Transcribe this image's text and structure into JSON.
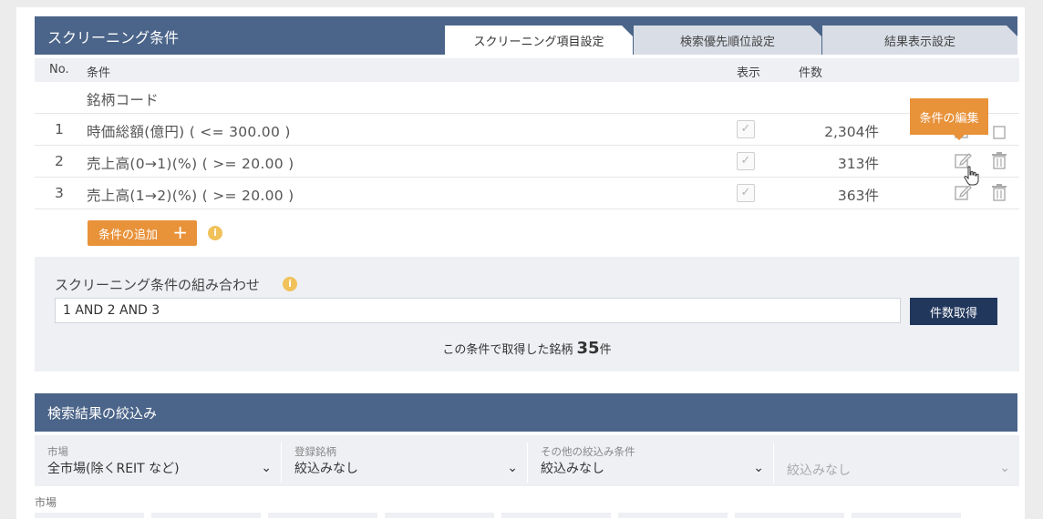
{
  "header": {
    "title": "スクリーニング条件",
    "tabs": [
      {
        "label": "スクリーニング項目設定",
        "active": true
      },
      {
        "label": "検索優先順位設定",
        "active": false
      },
      {
        "label": "結果表示設定",
        "active": false
      }
    ]
  },
  "columns": {
    "no": "No.",
    "condition": "条件",
    "display": "表示",
    "count": "件数"
  },
  "rows": [
    {
      "no": "",
      "condition": "銘柄コード",
      "count": ""
    },
    {
      "no": "1",
      "condition": "時価総額(億円) ( <= 300.00 )",
      "count": "2,304件"
    },
    {
      "no": "2",
      "condition": "売上高(0→1)(%) ( >= 20.00 )",
      "count": "313件"
    },
    {
      "no": "3",
      "condition": "売上高(1→2)(%) ( >= 20.00 )",
      "count": "363件"
    }
  ],
  "tooltip": "条件の編集",
  "add_condition": {
    "label": "条件の追加",
    "plus": "+"
  },
  "combination": {
    "title": "スクリーニング条件の組み合わせ",
    "value": "1 AND 2 AND 3",
    "button": "件数取得",
    "result_prefix": "この条件で取得した銘柄",
    "result_count": "35",
    "result_suffix": "件"
  },
  "filter_section": {
    "title": "検索結果の絞込み",
    "filters": [
      {
        "label": "市場",
        "value": "全市場(除くREIT など)",
        "enabled": true
      },
      {
        "label": "登録銘柄",
        "value": "絞込みなし",
        "enabled": true
      },
      {
        "label": "その他の絞込み条件",
        "value": "絞込みなし",
        "enabled": true
      },
      {
        "label": "",
        "value": "絞込みなし",
        "enabled": false
      }
    ],
    "bottom_label": "市場"
  },
  "colors": {
    "header_bg": "#4b6489",
    "accent": "#e8923a",
    "button_dark": "#22375c",
    "info": "#f1c15a"
  },
  "icons": {
    "info": "i",
    "check": "✓",
    "chevron": "⌄"
  }
}
